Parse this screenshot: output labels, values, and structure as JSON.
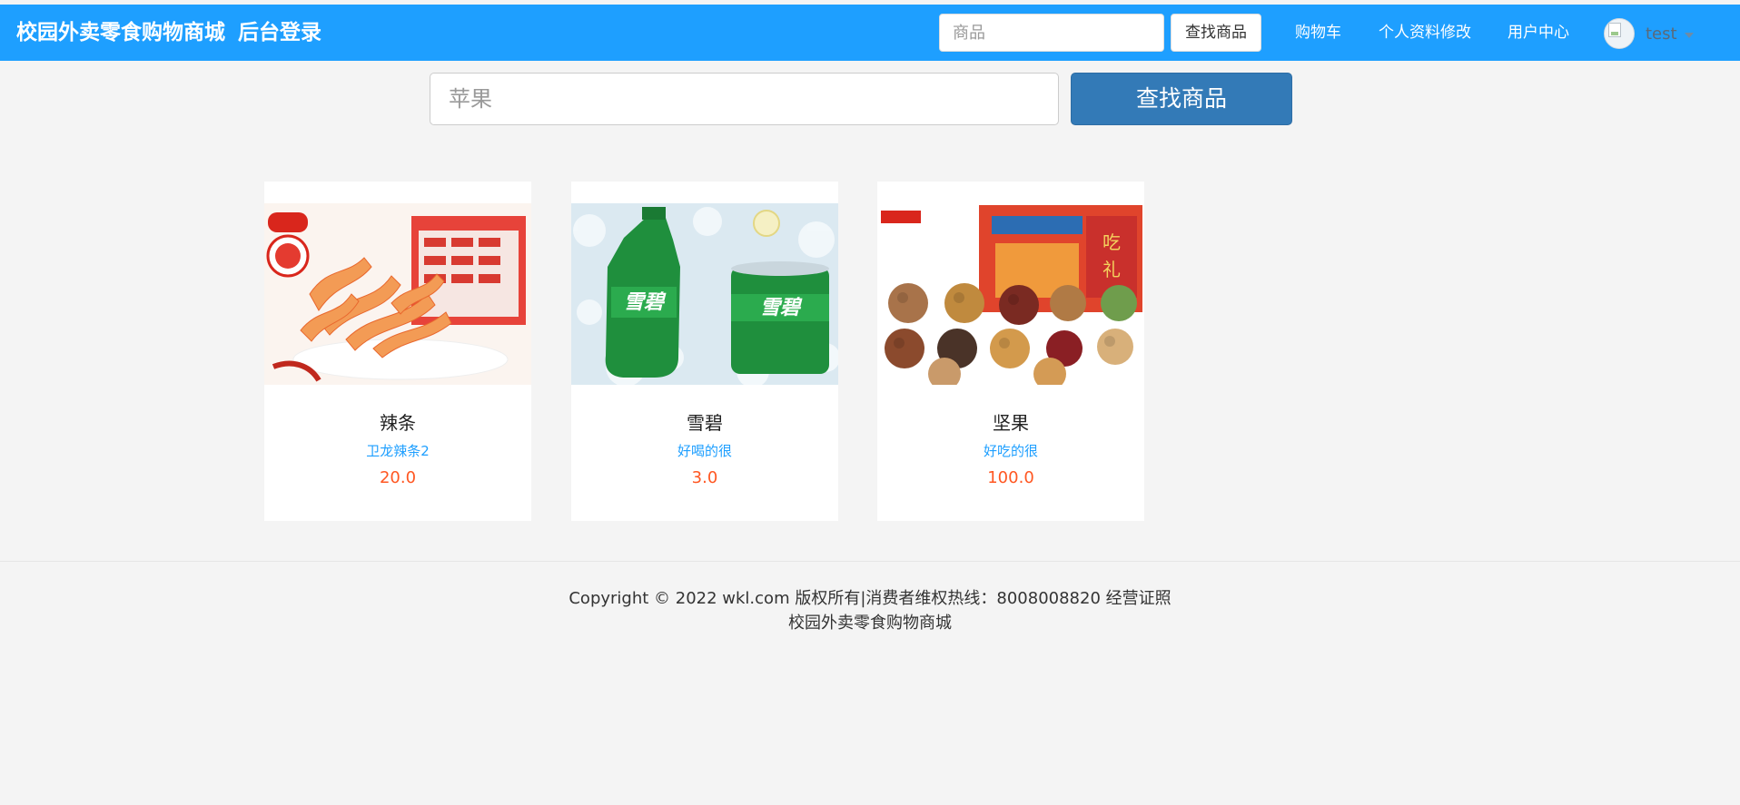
{
  "header": {
    "brand": "校园外卖零食购物商城",
    "admin_login": "后台登录",
    "search_placeholder": "商品",
    "search_button": "查找商品",
    "nav": {
      "cart": "购物车",
      "profile_edit": "个人资料修改",
      "user_center": "用户中心"
    },
    "username": "test"
  },
  "search": {
    "placeholder": "苹果",
    "button": "查找商品"
  },
  "products": [
    {
      "name": "辣条",
      "description": "卫龙辣条2",
      "price": "20.0"
    },
    {
      "name": "雪碧",
      "description": "好喝的很",
      "price": "3.0"
    },
    {
      "name": "坚果",
      "description": "好吃的很",
      "price": "100.0"
    }
  ],
  "footer": {
    "copyright": "Copyright © 2022 wkl.com 版权所有|消费者维权热线：8008008820 经营证照",
    "site_name": "校园外卖零食购物商城"
  },
  "colors": {
    "navbar": "#1e9fff",
    "primary_button": "#337ab7",
    "description_text": "#1e9fff",
    "price_text": "#ff5722",
    "page_background": "#f4f4f4"
  },
  "icons": [
    "avatar-image",
    "chevron-down-icon"
  ]
}
